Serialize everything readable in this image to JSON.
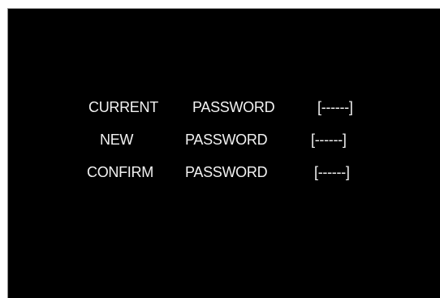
{
  "dialog": {
    "rows": [
      {
        "word1": "CURRENT",
        "word2": "PASSWORD",
        "value": "[------]"
      },
      {
        "word1": "NEW",
        "word2": "PASSWORD",
        "value": "[------]"
      },
      {
        "word1": "CONFIRM",
        "word2": "PASSWORD",
        "value": "[------]"
      }
    ]
  }
}
